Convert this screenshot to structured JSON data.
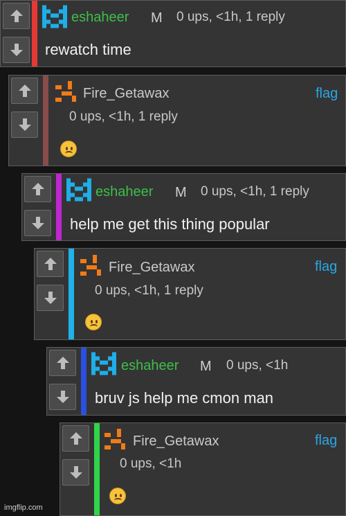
{
  "comments": [
    {
      "user": "eshaheer",
      "badge": "M",
      "meta": "0 ups, <1h, 1 reply",
      "body": "rewatch time",
      "bar_color": "#e53935",
      "avatar": "eshaheer-avatar"
    },
    {
      "user": "Fire_Getawax",
      "meta": "0 ups, <1h, 1 reply",
      "body": "☹",
      "flag": "flag",
      "bar_color": "#8a4b4b",
      "avatar": "fire-avatar"
    },
    {
      "user": "eshaheer",
      "badge": "M",
      "meta": "0 ups, <1h, 1 reply",
      "body": "help me get this thing popular",
      "bar_color": "#c026d3",
      "avatar": "eshaheer-avatar"
    },
    {
      "user": "Fire_Getawax",
      "meta": "0 ups, <1h, 1 reply",
      "body": "☹",
      "flag": "flag",
      "bar_color": "#1fb3ea",
      "avatar": "fire-avatar"
    },
    {
      "user": "eshaheer",
      "badge": "M",
      "meta": "0 ups, <1h",
      "body": "bruv js help me cmon man",
      "bar_color": "#2b4fe0",
      "avatar": "eshaheer-avatar"
    },
    {
      "user": "Fire_Getawax",
      "meta": "0 ups, <1h",
      "body": "☹",
      "flag": "flag",
      "bar_color": "#2fd44a",
      "avatar": "fire-avatar"
    }
  ],
  "colors": {
    "username_eshaheer": "#3cbf4b",
    "username_fire": "#c9c9c9",
    "link": "#2aa8e6"
  },
  "icons": {
    "upvote": "arrow-up-icon",
    "downvote": "arrow-down-icon"
  },
  "watermark": "imgflip.com"
}
